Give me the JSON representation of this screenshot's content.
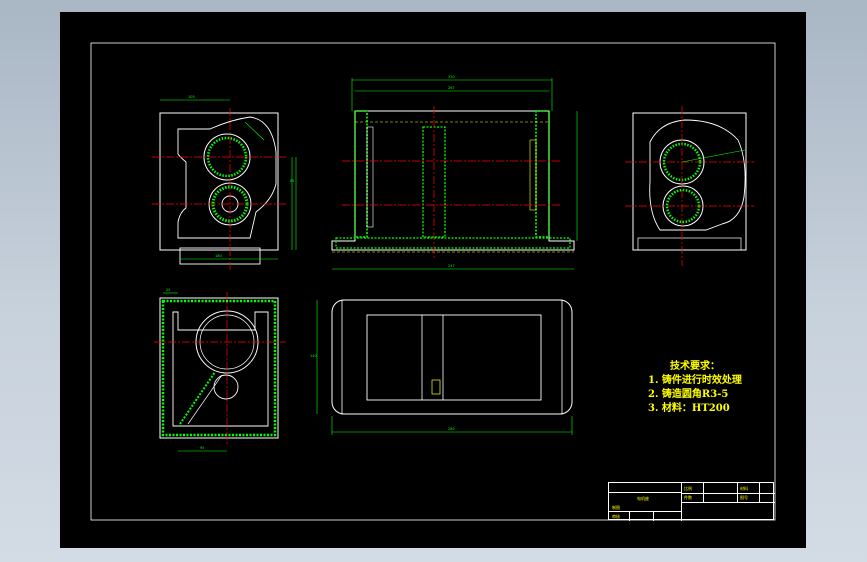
{
  "drawing": {
    "background": "#000000",
    "colors": {
      "frame": "#ffffff",
      "outline": "#ffffff",
      "dimension": "#00ff00",
      "centerline": "#ff0000",
      "hatch": "#00ff00",
      "text": "#ffff00",
      "leader": "#ff00ff",
      "hidden": "#ffff00"
    }
  },
  "views": {
    "top_left": {
      "dim_top": "105",
      "dim_bottom": "180",
      "dim_right": "85"
    },
    "top_middle": {
      "dim_overall": "330",
      "dim_inner": "267",
      "dim_bottom": "247"
    },
    "top_right": {},
    "bottom_left": {
      "dim_bottom": "95",
      "dim_top": "25"
    },
    "bottom_middle": {
      "dim_height": "140",
      "dim_width": "280"
    }
  },
  "tech_notes": {
    "title": "技术要求：",
    "items": [
      "1. 铸件进行时效处理",
      "2. 铸造圆角R3-5",
      "3. 材料：HT200"
    ]
  },
  "title_block": {
    "part_name": "电机座",
    "ratio_label": "比例",
    "quantity_label": "件数",
    "material_label": "材料",
    "drawing_no_label": "图号",
    "designer_label": "制图",
    "reviewer_label": "审核"
  }
}
